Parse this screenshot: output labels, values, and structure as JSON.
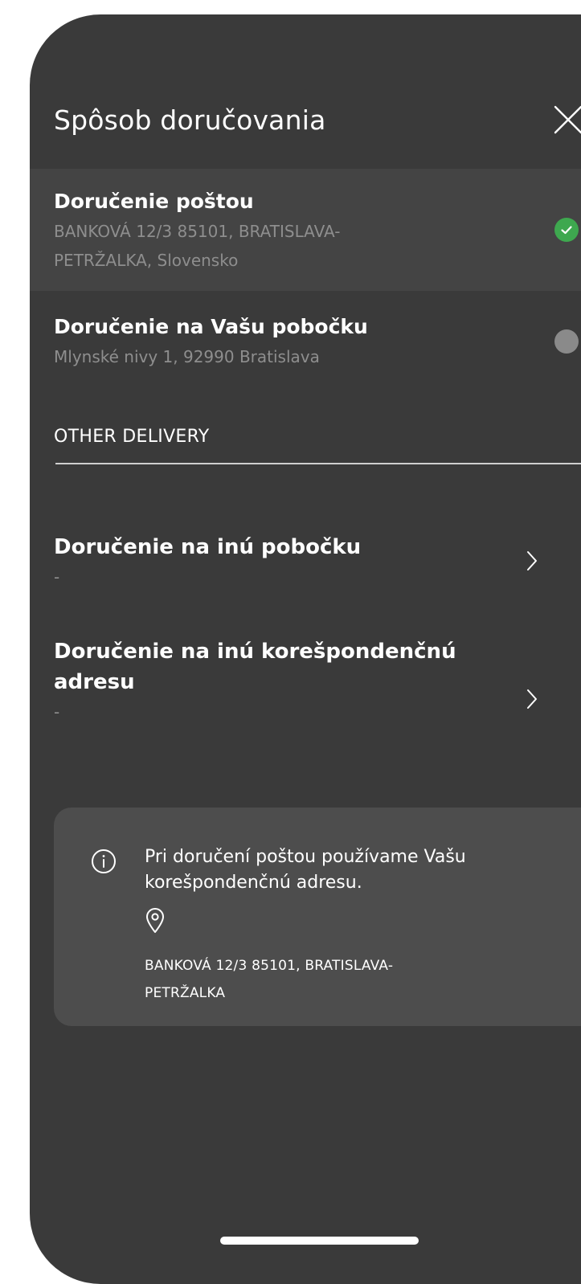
{
  "header": {
    "title": "Spôsob doručovania",
    "close_icon": "close-icon"
  },
  "options": [
    {
      "title": "Doručenie poštou",
      "subtitle": "BANKOVÁ 12/3 85101, BRATISLAVA-PETRŽALKA, Slovensko",
      "selected": true
    },
    {
      "title": "Doručenie na Vašu pobočku",
      "subtitle": "Mlynské nivy 1, 92990 Bratislava",
      "selected": false
    }
  ],
  "other_delivery": {
    "label": "OTHER DELIVERY",
    "items": [
      {
        "title": "Doručenie na inú pobočku",
        "subtitle": "-"
      },
      {
        "title": "Doručenie na inú korešpondenčnú adresu",
        "subtitle": "-"
      }
    ]
  },
  "info": {
    "icon": "info-icon",
    "text": "Pri doručení poštou používame Vašu korešpondenčnú adresu.",
    "pin_icon": "location-pin-icon",
    "address": "BANKOVÁ 12/3 85101, BRATISLAVA-PETRŽALKA"
  },
  "colors": {
    "background": "#3a3a3a",
    "selected_row": "#444444",
    "accent_green": "#3ea84f",
    "card": "#4d4d4d",
    "muted_text": "#8e8e8e"
  }
}
